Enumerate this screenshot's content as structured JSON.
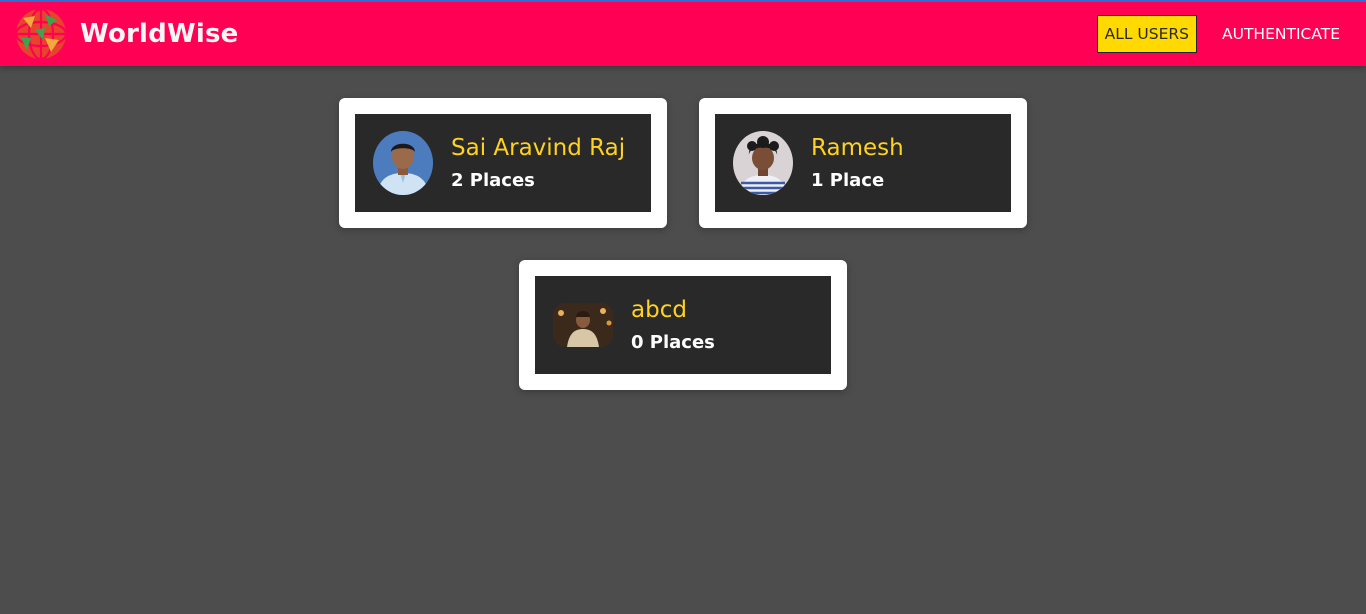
{
  "app": {
    "brand_name": "WorldWise",
    "logo_icon": "globe-logo-icon"
  },
  "nav": {
    "items": [
      {
        "label": "ALL USERS",
        "active": true
      },
      {
        "label": "AUTHENTICATE",
        "active": false
      }
    ]
  },
  "colors": {
    "header": "#ff0055",
    "page_background": "#4d4d4d",
    "card_inner": "#292929",
    "name_text": "#ffd21f",
    "active_nav": "#ffd900"
  },
  "users": [
    {
      "name": "Sai Aravind Raj",
      "places": "2 Places",
      "avatar": "user-photo-icon"
    },
    {
      "name": "Ramesh",
      "places": "1 Place",
      "avatar": "user-photo-icon"
    },
    {
      "name": "abcd",
      "places": "0 Places",
      "avatar": "user-photo-icon"
    }
  ]
}
